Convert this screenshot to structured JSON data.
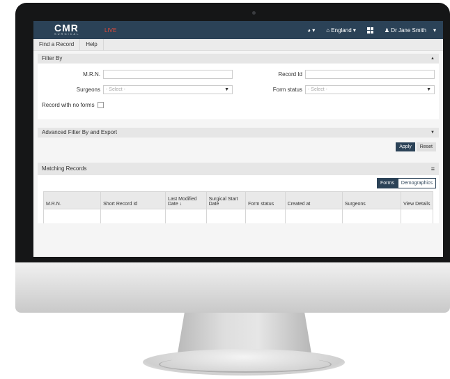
{
  "header": {
    "logo_text": "CMR",
    "logo_sub": "SURGICAL",
    "live_label": "LIVE",
    "help_label": "▾",
    "region_label": "England ▾",
    "user_name": "Dr Jane Smith",
    "user_caret": "▾"
  },
  "menu": {
    "items": [
      "Find a Record",
      "Help"
    ]
  },
  "filter": {
    "title": "Filter By",
    "mrn_label": "M.R.N.",
    "record_id_label": "Record Id",
    "surgeons_label": "Surgeons",
    "surgeons_placeholder": "- Select -",
    "form_status_label": "Form status",
    "form_status_placeholder": "- Select -",
    "no_forms_label": "Record with no forms"
  },
  "advanced": {
    "title": "Advanced Filter By and Export",
    "apply_label": "Apply",
    "reset_label": "Reset"
  },
  "records": {
    "title": "Matching Records",
    "forms_label": "Forms",
    "demographics_label": "Demographics",
    "columns": [
      "M.R.N.",
      "Short Record Id",
      "Last Modified Date ↓",
      "Surgical Start Date",
      "Form status",
      "Created at",
      "Surgeons",
      "View Details"
    ]
  },
  "colors": {
    "brand": "#2b4257",
    "live": "#e04a3b"
  }
}
